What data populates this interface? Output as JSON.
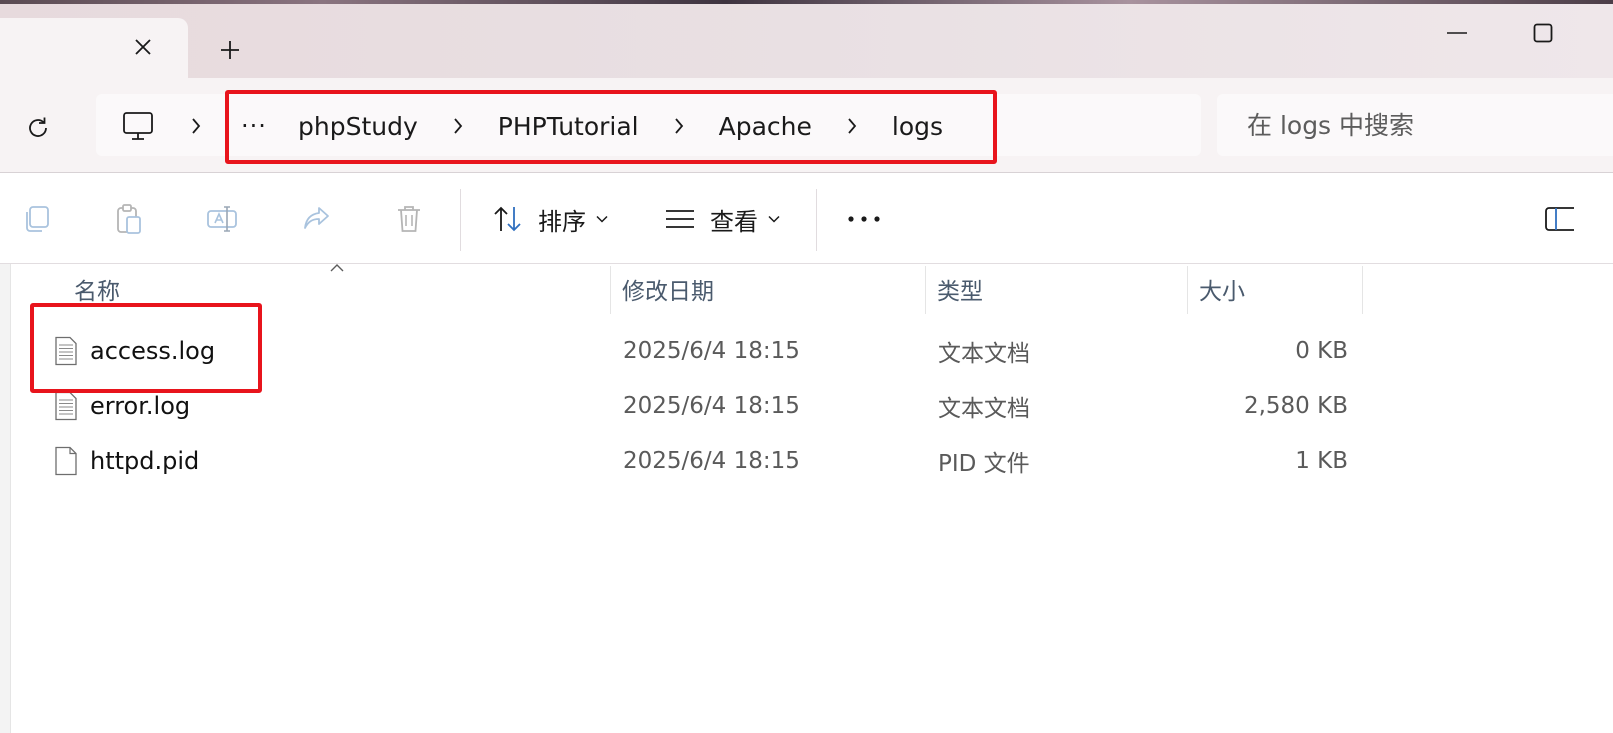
{
  "window": {
    "tab_close_glyph": "✕",
    "new_tab_glyph": "+"
  },
  "address_bar": {
    "overflow_label": "···",
    "crumbs": [
      {
        "label": "phpStudy"
      },
      {
        "label": "PHPTutorial"
      },
      {
        "label": "Apache"
      },
      {
        "label": "logs"
      }
    ]
  },
  "search": {
    "placeholder": "在 logs 中搜索"
  },
  "toolbar": {
    "sort_label": "排序",
    "view_label": "查看",
    "more_label": "···"
  },
  "columns": {
    "name": "名称",
    "date": "修改日期",
    "type": "类型",
    "size": "大小"
  },
  "files": [
    {
      "name": "access.log",
      "date": "2025/6/4 18:15",
      "type": "文本文档",
      "size": "0 KB",
      "icon": "text-file-icon"
    },
    {
      "name": "error.log",
      "date": "2025/6/4 18:15",
      "type": "文本文档",
      "size": "2,580 KB",
      "icon": "text-file-icon"
    },
    {
      "name": "httpd.pid",
      "date": "2025/6/4 18:15",
      "type": "PID 文件",
      "size": "1 KB",
      "icon": "blank-file-icon"
    }
  ],
  "colors": {
    "highlight_box": "#e8141c",
    "accent_blue": "#2f6fbf",
    "header_text": "#4a5a6d"
  }
}
